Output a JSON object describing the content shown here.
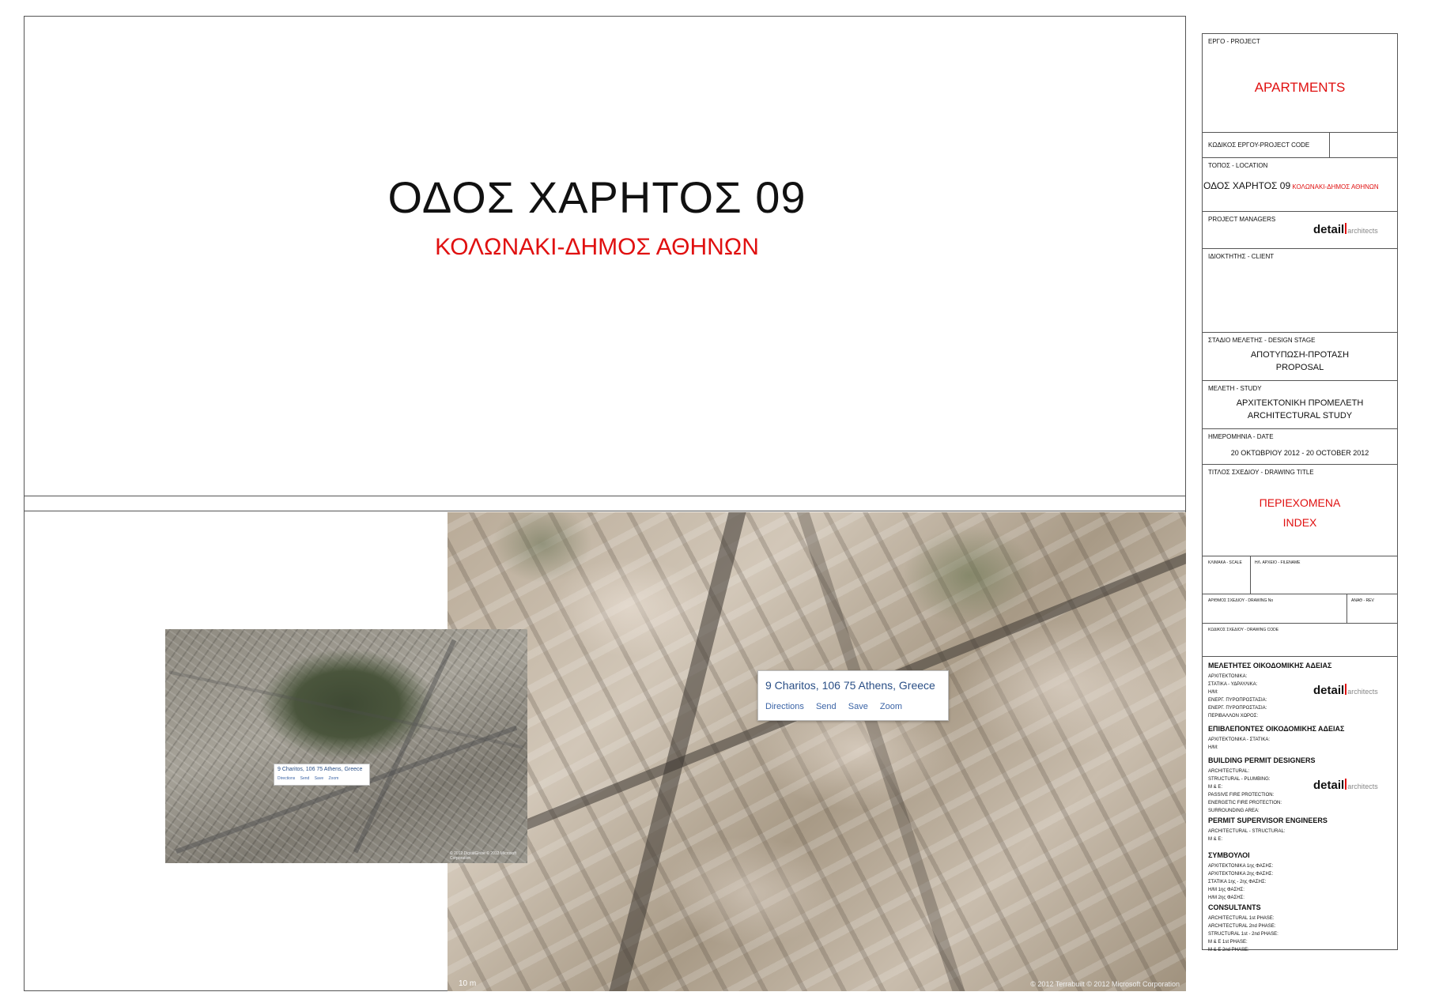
{
  "main": {
    "title": "ΟΔΟΣ ΧΑΡΗΤΟΣ  09",
    "subtitle": "ΚΟΛΩΝΑΚΙ-ΔΗΜΟΣ ΑΘΗΝΩΝ"
  },
  "aerial": {
    "address": "9 Charitos, 106 75 Athens, Greece",
    "actions": [
      "Directions",
      "Send",
      "Save",
      "Zoom"
    ],
    "scale": "10 m",
    "copyright": "© 2012 Terrabuilt   © 2012 Microsoft Corporation"
  },
  "satellite": {
    "address": "9 Charitos, 106 75 Athens, Greece",
    "actions": [
      "Directions",
      "Send",
      "Save",
      "Zoom"
    ],
    "copyright": "© 2012 DigitalGlobe  © 2012 Microsoft Corporation"
  },
  "titleblock": {
    "project_label": "ΕΡΓΟ - PROJECT",
    "project_value": "APARTMENTS",
    "code_label": "ΚΩΔΙΚΟΣ ΕΡΓΟΥ-PROJECT CODE",
    "location_label": "ΤΟΠΟΣ - LOCATION",
    "location_street": "ΟΔΟΣ ΧΑΡΗΤΟΣ  09",
    "location_area": "ΚΟΛΩΝΑΚΙ-ΔΗΜΟΣ ΑΘΗΝΩΝ",
    "managers_label": "PROJECT MANAGERS",
    "logo_main": "detail",
    "logo_sub": "architects",
    "client_label": "ΙΔΙΟΚΤΗΤΗΣ - CLIENT",
    "stage_label": "ΣΤΑΔΙΟ ΜΕΛΕΤΗΣ - DESIGN STAGE",
    "stage_gr": "ΑΠΟΤΥΠΩΣΗ-ΠΡΟΤΑΣΗ",
    "stage_en": "PROPOSAL",
    "study_label": "ΜΕΛΕΤΗ - STUDY",
    "study_gr": "ΑΡΧΙΤΕΚΤΟΝΙΚΗ ΠΡΟΜΕΛΕΤΗ",
    "study_en": "ARCHITECTURAL STUDY",
    "date_label": "ΗΜΕΡΟΜΗΝΙΑ - DATE",
    "date_value": "20 ΟΚΤΩΒΡΙΟΥ 2012 - 20  OCTOBER 2012",
    "drawing_title_label": "ΤΙΤΛΟΣ ΣΧΕΔΙΟΥ - DRAWING TITLE",
    "drawing_title_gr": "ΠΕΡΙΕΧΟΜΕΝΑ",
    "drawing_title_en": "INDEX",
    "scale_label": "ΚΛΙΜΑΚΑ - SCALE",
    "filename_label": "ΗΛ. ΑΡΧΕΙΟ - FILENAME",
    "drawing_no_label": "ΑΡΙΘΜΟΣ ΣΧΕΔΙΟΥ - DRAWING No",
    "rev_label": "ΑΝΑΘ - REV",
    "drawing_code_label": "ΚΩΔΙΚΟΣ ΣΧΕΔΙΟΥ - DRAWING CODE",
    "permit_gr_head": "ΜΕΛΕΤΗΤΕΣ ΟΙΚΟΔΟΜΙΚΗΣ ΑΔΕΙΑΣ",
    "permit_gr_items": [
      "ΑΡΧΙΤΕΚΤΟΝΙΚΑ:",
      "ΣΤΑΤΙΚΑ - ΥΔΡΑΥΛΙΚΑ:",
      "Η/Μ:",
      "ΕΝΕΡΓ. ΠΥΡΟΠΡΟΣΤΑΣΙΑ:",
      "ΕΝΕΡΓ. ΠΥΡΟΠΡΟΣΤΑΣΙΑ:",
      "ΠΕΡΙΒΑΛΛΟΝ ΧΩΡΟΣ:"
    ],
    "supervisor_gr_head": "ΕΠΙΒΛΕΠΟΝΤΕΣ ΟΙΚΟΔΟΜΙΚΗΣ ΑΔΕΙΑΣ",
    "supervisor_gr_items": [
      "ΑΡΧΙΤΕΚΤΟΝΙΚΑ - ΣΤΑΤΙΚΑ:",
      "Η/Μ:"
    ],
    "permit_en_head": "BUILDING PERMIT DESIGNERS",
    "permit_en_items": [
      "ARCHITECTURAL:",
      "STRUCTURAL - PLUMBING:",
      "M & E:",
      "PASSIVE FIRE PROTECTION:",
      "ENERGETIC FIRE PROTECTION:",
      "SURROUNDING AREA:"
    ],
    "supervisor_en_head": "PERMIT SUPERVISOR ENGINEERS",
    "supervisor_en_items": [
      "ARCHITECTURAL - STRUCTURAL:",
      "M & E:"
    ],
    "consult_gr_head": "ΣΥΜΒΟΥΛΟΙ",
    "consult_gr_items": [
      "ΑΡΧΙΤΕΚΤΟΝΙΚΑ 1ης ΦΑΣΗΣ:",
      "ΑΡΧΙΤΕΚΤΟΝΙΚΑ 2ης ΦΑΣΗΣ:",
      "ΣΤΑΤΙΚΑ 1ης - 2ης ΦΑΣΗΣ:",
      "Η/Μ 1ης ΦΑΣΗΣ:",
      "Η/Μ 2ης ΦΑΣΗΣ:"
    ],
    "consult_en_head": "CONSULTANTS",
    "consult_en_items": [
      "ARCHITECTURAL 1st PHASE:",
      "ARCHITECTURAL 2nd PHASE:",
      "STRUCTURAL 1st - 2nd PHASE:",
      "M & E 1st PHASE:",
      "M & E 2nd PHASE:"
    ]
  }
}
